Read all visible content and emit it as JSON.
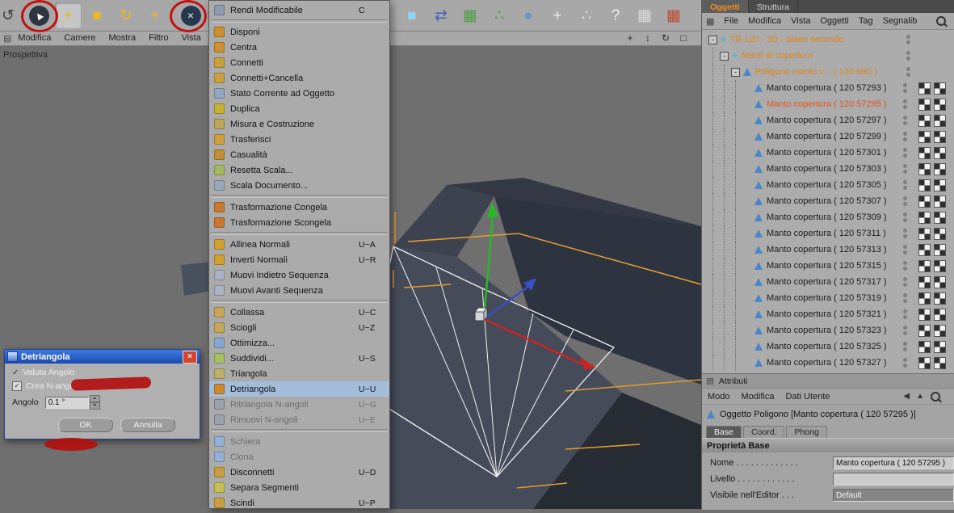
{
  "toolbar": {
    "left_icons": [
      {
        "name": "undo-icon",
        "glyph": "↺",
        "fg": "#3c4248",
        "partial": true
      },
      {
        "name": "live-selection-tool-icon",
        "glyph": "▲",
        "fg": "#f2f2f2",
        "circle": "#2d3640",
        "rotate": -35
      },
      {
        "name": "move-tool-icon",
        "glyph": "+",
        "fg": "#e8b920",
        "pressed": true
      },
      {
        "name": "scale-tool-icon",
        "glyph": "■",
        "fg": "#e8b920"
      },
      {
        "name": "rotate-tool-icon",
        "glyph": "↻",
        "fg": "#e8b920"
      },
      {
        "name": "coordinates-tool-icon",
        "glyph": "+",
        "fg": "#e8b920"
      },
      {
        "name": "x-axis-lock-icon",
        "glyph": "×",
        "fg": "#f2f2f2",
        "circle": "#26384e"
      }
    ],
    "center_icons": [
      {
        "name": "add-cube-icon",
        "glyph": "■",
        "fg": "#8fd4f2"
      },
      {
        "name": "swap-views-icon",
        "glyph": "⇄",
        "fg": "#3c66b0"
      },
      {
        "name": "array-object-icon",
        "glyph": "▦",
        "fg": "#4f9e44"
      },
      {
        "name": "cluster-object-icon",
        "glyph": "∴",
        "fg": "#4f9e44"
      },
      {
        "name": "metaball-object-icon",
        "glyph": "●",
        "fg": "#7490cc"
      },
      {
        "name": "move-axis-icon",
        "glyph": "+",
        "fg": "#ececec"
      },
      {
        "name": "particles-icon",
        "glyph": "∴",
        "fg": "#e0e0e0"
      },
      {
        "name": "help-icon",
        "glyph": "?",
        "fg": "#f0f0f0"
      },
      {
        "name": "spreadsheet-icon",
        "glyph": "▦",
        "fg": "#dcdcdc"
      },
      {
        "name": "layout-grid-icon",
        "glyph": "▦",
        "fg": "#bf4a33"
      }
    ]
  },
  "viewport": {
    "label": "Prospettiva",
    "menu": [
      "Modifica",
      "Camere",
      "Mostra",
      "Filtro",
      "Vista"
    ],
    "nav_icons": [
      {
        "name": "view-pan-icon",
        "glyph": "+"
      },
      {
        "name": "view-zoom-icon",
        "glyph": "↕"
      },
      {
        "name": "view-rotate-icon",
        "glyph": "↻"
      },
      {
        "name": "view-maximize-icon",
        "glyph": "□"
      }
    ]
  },
  "context_menu": {
    "items": [
      {
        "label": "Rendi Modificabile",
        "shortcut": "C",
        "icon": "#8c9cb4"
      },
      {
        "label": "Disponi",
        "icon": "#d09030",
        "sep_before": true
      },
      {
        "label": "Centra",
        "icon": "#d09030"
      },
      {
        "label": "Connetti",
        "icon": "#c8a040"
      },
      {
        "label": "Connetti+Cancella",
        "icon": "#c8a040"
      },
      {
        "label": "Stato Corrente ad Oggetto",
        "icon": "#90a8c0"
      },
      {
        "label": "Duplica",
        "icon": "#c8b030"
      },
      {
        "label": "Misura e Costruzione",
        "icon": "#b8a858"
      },
      {
        "label": "Trasferisci",
        "icon": "#d0a040"
      },
      {
        "label": "Casualità",
        "icon": "#c09038"
      },
      {
        "label": "Resetta Scala...",
        "icon": "#a8b860"
      },
      {
        "label": "Scala Documento...",
        "icon": "#98a8b8"
      },
      {
        "label": "Trasformazione Congela",
        "icon": "#c87830",
        "sep_before": true
      },
      {
        "label": "Trasformazione Scongela",
        "icon": "#c87830"
      },
      {
        "label": "Allinea Normali",
        "shortcut": "U~A",
        "icon": "#d0a030",
        "sep_before": true
      },
      {
        "label": "Inverti Normali",
        "shortcut": "U~R",
        "icon": "#d0a030"
      },
      {
        "label": "Muovi Indietro Sequenza",
        "icon": "#aab4c4"
      },
      {
        "label": "Muovi Avanti Sequenza",
        "icon": "#aab4c4"
      },
      {
        "label": "Collassa",
        "shortcut": "U~C",
        "icon": "#c8a858",
        "sep_before": true
      },
      {
        "label": "Sciogli",
        "shortcut": "U~Z",
        "icon": "#c8a858"
      },
      {
        "label": "Ottimizza...",
        "icon": "#88a8d0"
      },
      {
        "label": "Suddividi...",
        "shortcut": "U~S",
        "icon": "#a8c060"
      },
      {
        "label": "Triangola",
        "icon": "#c0b068"
      },
      {
        "label": "Detriangola",
        "shortcut": "U~U",
        "icon": "#d08830",
        "highlighted": true
      },
      {
        "label": "Ritriangola N-angoli",
        "shortcut": "U~G",
        "icon": "#9aa2ae",
        "disabled": true
      },
      {
        "label": "Rimuovi N-angoli",
        "shortcut": "U~E",
        "icon": "#9aa2ae",
        "disabled": true
      },
      {
        "label": "Schiera",
        "icon": "#93b1d6",
        "sep_before": true,
        "disabled": true
      },
      {
        "label": "Clona",
        "icon": "#93b1d6",
        "disabled": true
      },
      {
        "label": "Disconnetti",
        "shortcut": "U~D",
        "icon": "#c8a040"
      },
      {
        "label": "Separa Segmenti",
        "icon": "#c8c050"
      },
      {
        "label": "Scindi",
        "shortcut": "U~P",
        "icon": "#c8a040"
      }
    ]
  },
  "dialog": {
    "title": "Detriangola",
    "options": [
      {
        "label": "Valuta Angolo",
        "checked": true
      },
      {
        "label": "Crea N-angoli",
        "checked": true
      }
    ],
    "angle_label": "Angolo",
    "angle_value": "0.1 °",
    "ok_label": "OK",
    "cancel_label": "Annulla"
  },
  "object_manager": {
    "tabs": [
      {
        "label": "Oggetti",
        "active": true
      },
      {
        "label": "Struttura",
        "active": false
      }
    ],
    "menu": [
      "File",
      "Modifica",
      "Vista",
      "Oggetti",
      "Tag",
      "Segnalib"
    ],
    "tree": [
      {
        "label": "TB 120 - 3D - piano secondo",
        "depth": 0,
        "type": "null",
        "expanded": true,
        "orange": true
      },
      {
        "label": "Manti di copertura",
        "depth": 1,
        "type": "null",
        "expanded": true,
        "orange": true
      },
      {
        "label": "Poligono manto c... ( 120 690 )",
        "depth": 2,
        "type": "polygon",
        "expanded": true,
        "orange": true
      },
      {
        "label": "Manto copertura ( 120 57293 )",
        "depth": 3,
        "type": "polygon",
        "tags": 2
      },
      {
        "label": "Manto copertura ( 120 57295 )",
        "depth": 3,
        "type": "polygon",
        "tags": 2,
        "selected": true
      },
      {
        "label": "Manto copertura ( 120 57297 )",
        "depth": 3,
        "type": "polygon",
        "tags": 2
      },
      {
        "label": "Manto copertura ( 120 57299 )",
        "depth": 3,
        "type": "polygon",
        "tags": 2
      },
      {
        "label": "Manto copertura ( 120 57301 )",
        "depth": 3,
        "type": "polygon",
        "tags": 2
      },
      {
        "label": "Manto copertura ( 120 57303 )",
        "depth": 3,
        "type": "polygon",
        "tags": 2
      },
      {
        "label": "Manto copertura ( 120 57305 )",
        "depth": 3,
        "type": "polygon",
        "tags": 2
      },
      {
        "label": "Manto copertura ( 120 57307 )",
        "depth": 3,
        "type": "polygon",
        "tags": 2
      },
      {
        "label": "Manto copertura ( 120 57309 )",
        "depth": 3,
        "type": "polygon",
        "tags": 2
      },
      {
        "label": "Manto copertura ( 120 57311 )",
        "depth": 3,
        "type": "polygon",
        "tags": 2
      },
      {
        "label": "Manto copertura ( 120 57313 )",
        "depth": 3,
        "type": "polygon",
        "tags": 2
      },
      {
        "label": "Manto copertura ( 120 57315 )",
        "depth": 3,
        "type": "polygon",
        "tags": 2
      },
      {
        "label": "Manto copertura ( 120 57317 )",
        "depth": 3,
        "type": "polygon",
        "tags": 2
      },
      {
        "label": "Manto copertura ( 120 57319 )",
        "depth": 3,
        "type": "polygon",
        "tags": 2
      },
      {
        "label": "Manto copertura ( 120 57321 )",
        "depth": 3,
        "type": "polygon",
        "tags": 2
      },
      {
        "label": "Manto copertura ( 120 57323 )",
        "depth": 3,
        "type": "polygon",
        "tags": 2
      },
      {
        "label": "Manto copertura ( 120 57325 )",
        "depth": 3,
        "type": "polygon",
        "tags": 2
      },
      {
        "label": "Manto copertura ( 120 57327 )",
        "depth": 3,
        "type": "polygon",
        "tags": 2
      }
    ]
  },
  "attributes": {
    "title": "Attributi",
    "menu": [
      "Modo",
      "Modifica",
      "Dati Utente"
    ],
    "menu_icons": [
      {
        "name": "previous-object-icon",
        "glyph": "◀"
      },
      {
        "name": "pin-icon",
        "glyph": "▲"
      },
      {
        "name": "search-icon",
        "glyph": "mag"
      }
    ],
    "object_label": "Oggetto Poligono [Manto copertura ( 120 57295 )]",
    "tabs": [
      {
        "label": "Base",
        "active": true
      },
      {
        "label": "Coord.",
        "active": false
      },
      {
        "label": "Phong",
        "active": false
      }
    ],
    "section": "Proprietà Base",
    "fields": [
      {
        "name": "nome",
        "label": "Nome . . . . . . . . . . . . .",
        "value": "Manto copertura ( 120 57295 )",
        "variant": "input"
      },
      {
        "name": "livello",
        "label": "Livello . . . . . . . . . . . .",
        "value": "",
        "variant": "input"
      },
      {
        "name": "visibile-nell-editor",
        "label": "Visibile nell'Editor . . .",
        "value": "Default",
        "variant": "dropdown"
      }
    ]
  },
  "colors": {
    "selection_orange": "#e08619",
    "selected_object_red": "#e25417",
    "menu_highlight_blue": "#a3bddb",
    "annotation_red": "#b21010",
    "axis_green": "#28b828",
    "axis_red": "#cc2424",
    "axis_blue": "#3850c8",
    "edge_orange": "#e09a30"
  }
}
